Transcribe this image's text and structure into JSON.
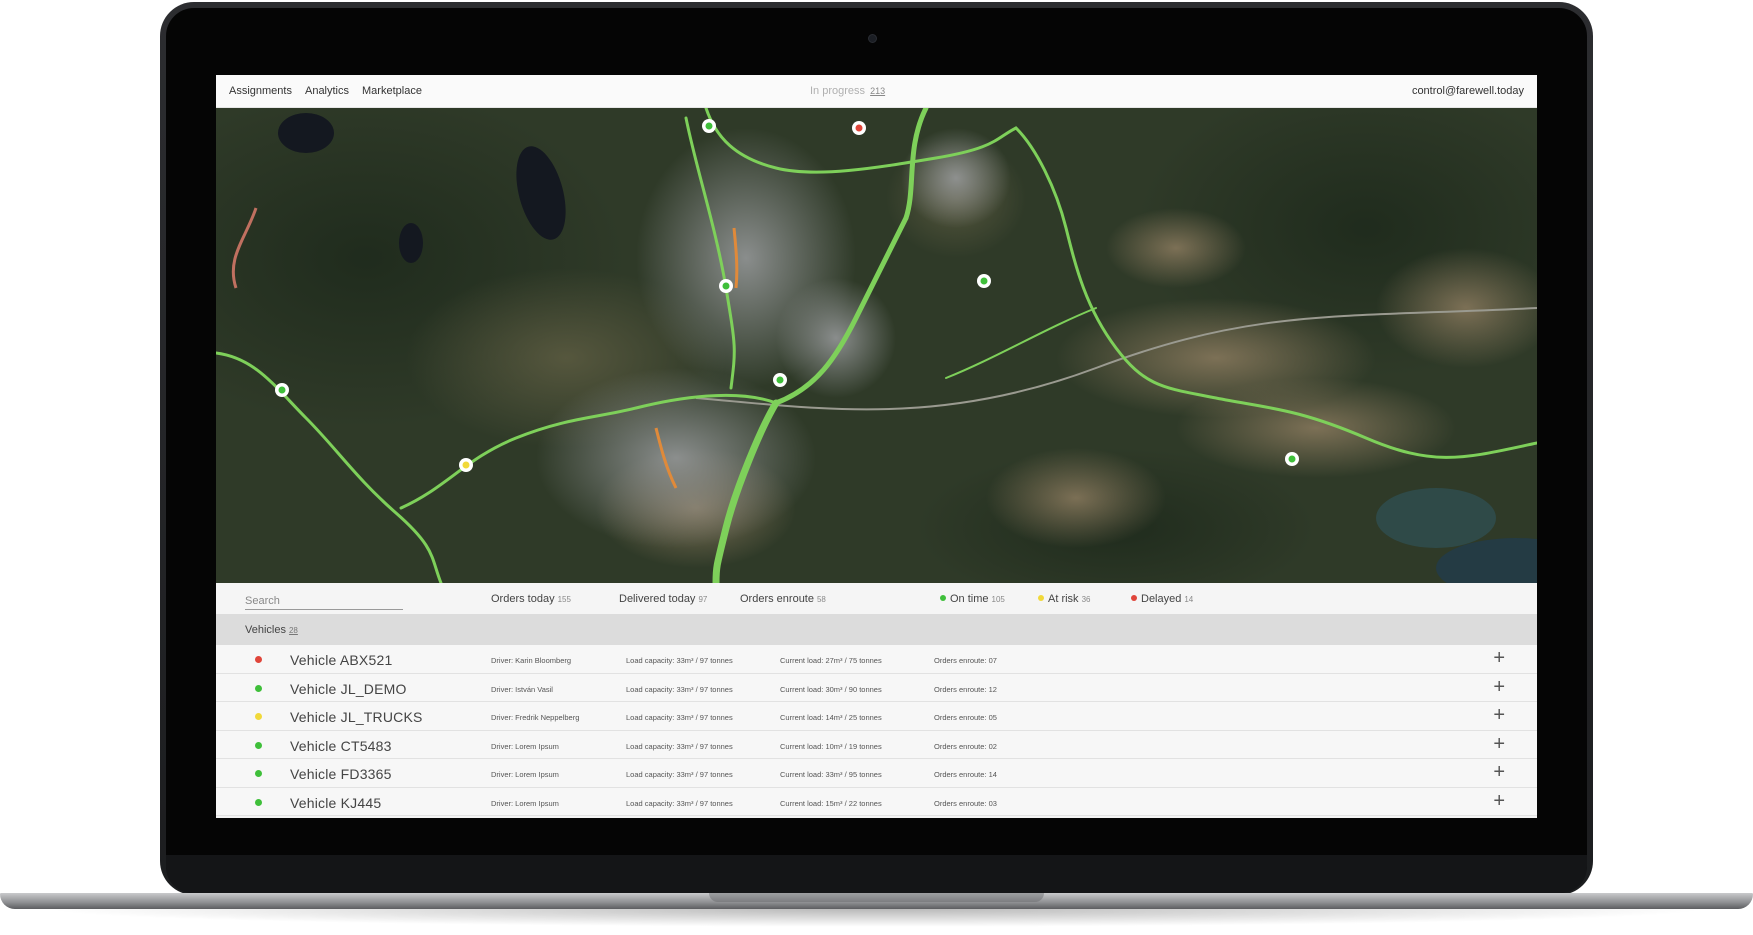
{
  "colors": {
    "on_time": "#3fbf3a",
    "at_risk": "#f1d93a",
    "delayed": "#e0453a",
    "route": "#7ed05a"
  },
  "nav": [
    {
      "label": "Assignments"
    },
    {
      "label": "Analytics"
    },
    {
      "label": "Marketplace"
    }
  ],
  "in_progress": {
    "label": "In progress",
    "count": "213"
  },
  "user_email": "control@farewell.today",
  "search": {
    "placeholder": "Search"
  },
  "stats": {
    "orders_today": {
      "label": "Orders today",
      "value": "155"
    },
    "delivered_today": {
      "label": "Delivered today",
      "value": "97"
    },
    "orders_enroute": {
      "label": "Orders enroute",
      "value": "58"
    },
    "on_time": {
      "label": "On time",
      "value": "105"
    },
    "at_risk": {
      "label": "At risk",
      "value": "36"
    },
    "delayed": {
      "label": "Delayed",
      "value": "14"
    }
  },
  "vehicles": {
    "label": "Vehicles",
    "count": "28",
    "rows": [
      {
        "status": "delayed",
        "name": "Vehicle ABX521",
        "driver": "Driver: Karin Bloomberg",
        "capacity": "Load capacity: 33m³ / 97 tonnes",
        "load": "Current load: 27m³ / 75 tonnes",
        "orders": "Orders enroute: 07"
      },
      {
        "status": "on_time",
        "name": "Vehicle JL_DEMO",
        "driver": "Driver: István Vasil",
        "capacity": "Load capacity: 33m³ / 97 tonnes",
        "load": "Current load: 30m³ / 90 tonnes",
        "orders": "Orders enroute: 12"
      },
      {
        "status": "at_risk",
        "name": "Vehicle JL_TRUCKS",
        "driver": "Driver: Fredrik Neppelberg",
        "capacity": "Load capacity: 33m³ / 97 tonnes",
        "load": "Current load: 14m³ / 25 tonnes",
        "orders": "Orders enroute: 05"
      },
      {
        "status": "on_time",
        "name": "Vehicle CT5483",
        "driver": "Driver: Lorem Ipsum",
        "capacity": "Load capacity: 33m³ / 97 tonnes",
        "load": "Current load: 10m³ / 19 tonnes",
        "orders": "Orders enroute: 02"
      },
      {
        "status": "on_time",
        "name": "Vehicle FD3365",
        "driver": "Driver: Lorem Ipsum",
        "capacity": "Load capacity: 33m³ / 97 tonnes",
        "load": "Current load: 33m³ / 95 tonnes",
        "orders": "Orders enroute: 14"
      },
      {
        "status": "on_time",
        "name": "Vehicle KJ445",
        "driver": "Driver: Lorem Ipsum",
        "capacity": "Load capacity: 33m³ / 97 tonnes",
        "load": "Current load: 15m³ / 22 tonnes",
        "orders": "Orders enroute: 03"
      }
    ]
  },
  "map_markers": [
    {
      "status": "on_time"
    },
    {
      "status": "delayed"
    },
    {
      "status": "on_time"
    },
    {
      "status": "on_time"
    },
    {
      "status": "on_time"
    },
    {
      "status": "at_risk"
    },
    {
      "status": "on_time"
    },
    {
      "status": "on_time"
    }
  ]
}
